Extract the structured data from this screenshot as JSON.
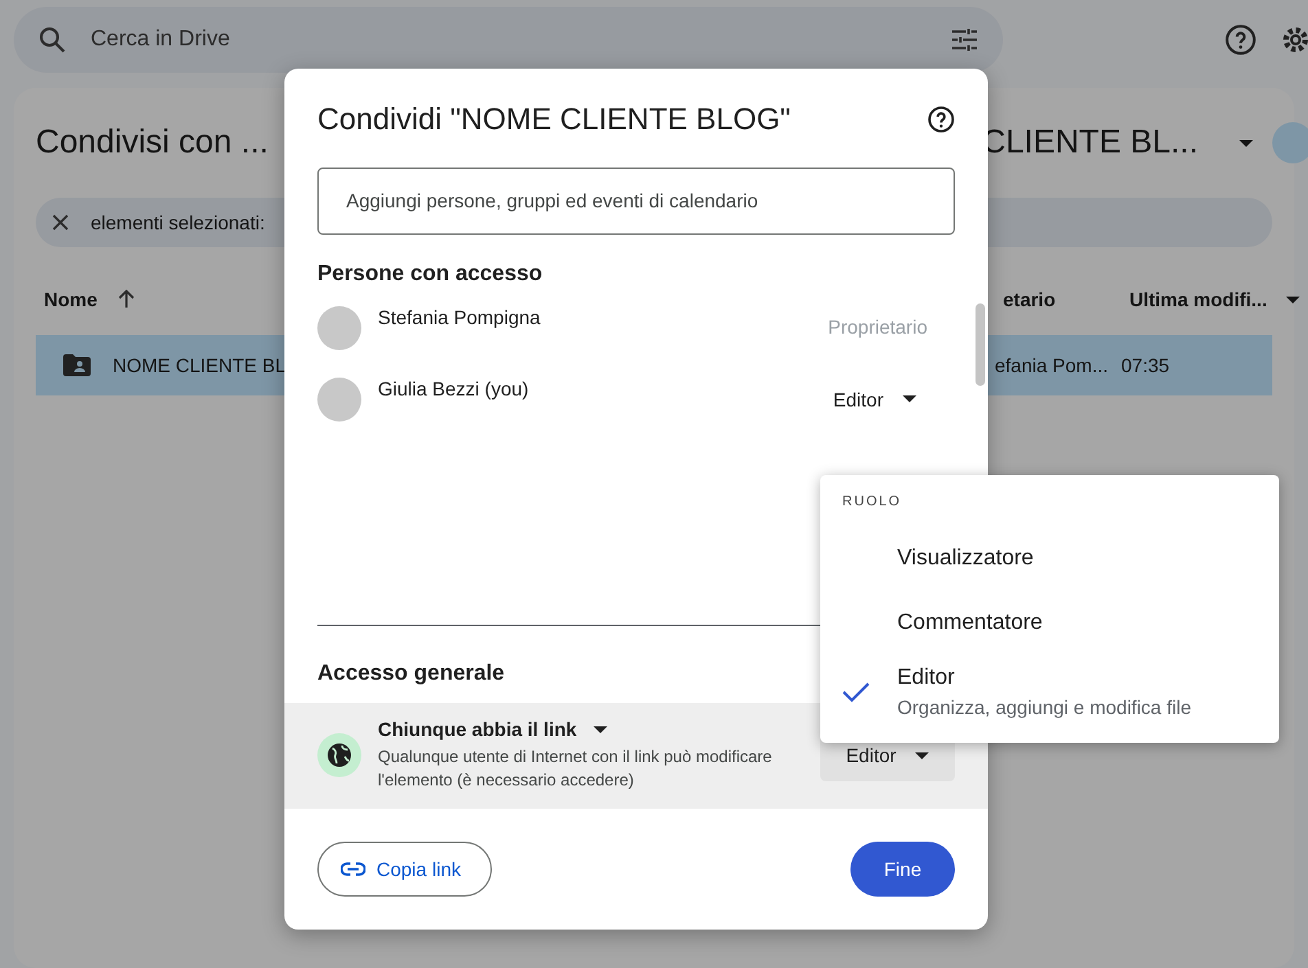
{
  "drive": {
    "search": {
      "placeholder": "Cerca in Drive"
    },
    "page_title": "Condivisi con ...",
    "folder_title": "CLIENTE BL...",
    "selection_bar": {
      "text": "elementi selezionati:"
    },
    "table": {
      "columns": [
        {
          "label": "Nome",
          "sorted": true,
          "menu": false
        },
        {
          "label": "etario",
          "sorted": false,
          "menu": false
        },
        {
          "label": "Ultima modifi...",
          "sorted": false,
          "menu": true
        }
      ],
      "rows": [
        {
          "cells": [
            "NOME CLIENTE BL",
            "efania Pom...",
            "07:35"
          ],
          "selected": true
        }
      ]
    }
  },
  "dialog": {
    "title": "Condividi \"NOME CLIENTE BLOG\"",
    "add_field": {
      "placeholder": "Aggiungi persone, gruppi ed eventi di calendario"
    },
    "people_heading": "Persone con accesso",
    "people": [
      {
        "name": "Stefania Pompigna",
        "role": "Proprietario",
        "kind": "owner"
      },
      {
        "name": "Giulia Bezzi (you)",
        "role": "Editor",
        "kind": "dropdown"
      }
    ],
    "general_heading": "Accesso generale",
    "general_access": {
      "scope": "Chiunque abbia il link",
      "description": "Qualunque utente di Internet con il link può modificare l'elemento (è necessario accedere)",
      "role": "Editor"
    },
    "copy_link": "Copia link",
    "done": "Fine"
  },
  "role_menu": {
    "heading": "RUOLO",
    "items": [
      {
        "label": "Visualizzatore",
        "selected": false
      },
      {
        "label": "Commentatore",
        "selected": false
      },
      {
        "label": "Editor",
        "description": "Organizza, aggiungi e modifica file",
        "selected": true
      }
    ]
  }
}
